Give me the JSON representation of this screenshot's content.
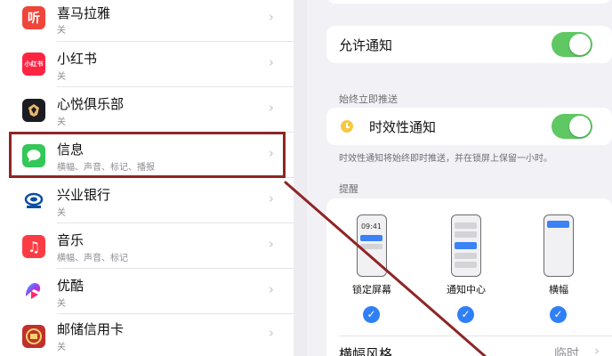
{
  "app_list": [
    {
      "name": "喜马拉雅",
      "sub": "关",
      "icon": "ximalaya-icon",
      "icon_text": "听",
      "color": "#f0453a"
    },
    {
      "name": "小红书",
      "sub": "关",
      "icon": "xiaohongshu-icon",
      "icon_text": "小红书",
      "color": "#ff2442"
    },
    {
      "name": "心悦俱乐部",
      "sub": "关",
      "icon": "xinyue-club-icon",
      "icon_text": "",
      "color": "#1b1b22"
    },
    {
      "name": "信息",
      "sub": "横幅、声音、标记、播报",
      "icon": "messages-icon",
      "icon_text": "",
      "color": "#34c759"
    },
    {
      "name": "兴业银行",
      "sub": "关",
      "icon": "cib-bank-icon",
      "icon_text": "",
      "color": "#ffffff"
    },
    {
      "name": "音乐",
      "sub": "横幅、声音、标记",
      "icon": "music-icon",
      "icon_text": "♫",
      "color": "#fc3c44"
    },
    {
      "name": "优酷",
      "sub": "关",
      "icon": "youku-icon",
      "icon_text": "",
      "color": "#ffffff"
    },
    {
      "name": "邮储信用卡",
      "sub": "关",
      "icon": "psbc-card-icon",
      "icon_text": "",
      "color": "#c0312b"
    }
  ],
  "settings": {
    "allow_notifications_label": "允许通知",
    "allow_notifications_on": true,
    "always_deliver_header": "始终立即推送",
    "time_sensitive_label": "时效性通知",
    "time_sensitive_on": true,
    "time_sensitive_footnote": "时效性通知将始终即时推送，并在锁屏上保留一小时。",
    "alerts_header": "提醒",
    "alert_styles": [
      {
        "label": "锁定屏幕",
        "checked": true,
        "preview_time": "09:41"
      },
      {
        "label": "通知中心",
        "checked": true
      },
      {
        "label": "横幅",
        "checked": true
      }
    ],
    "banner_style_label": "横幅风格",
    "banner_style_value": "临时"
  },
  "colors": {
    "toggle_on": "#5fc863",
    "check_blue": "#2f7ff7",
    "highlight_border": "#8f2525",
    "arrow": "#8f2525"
  }
}
